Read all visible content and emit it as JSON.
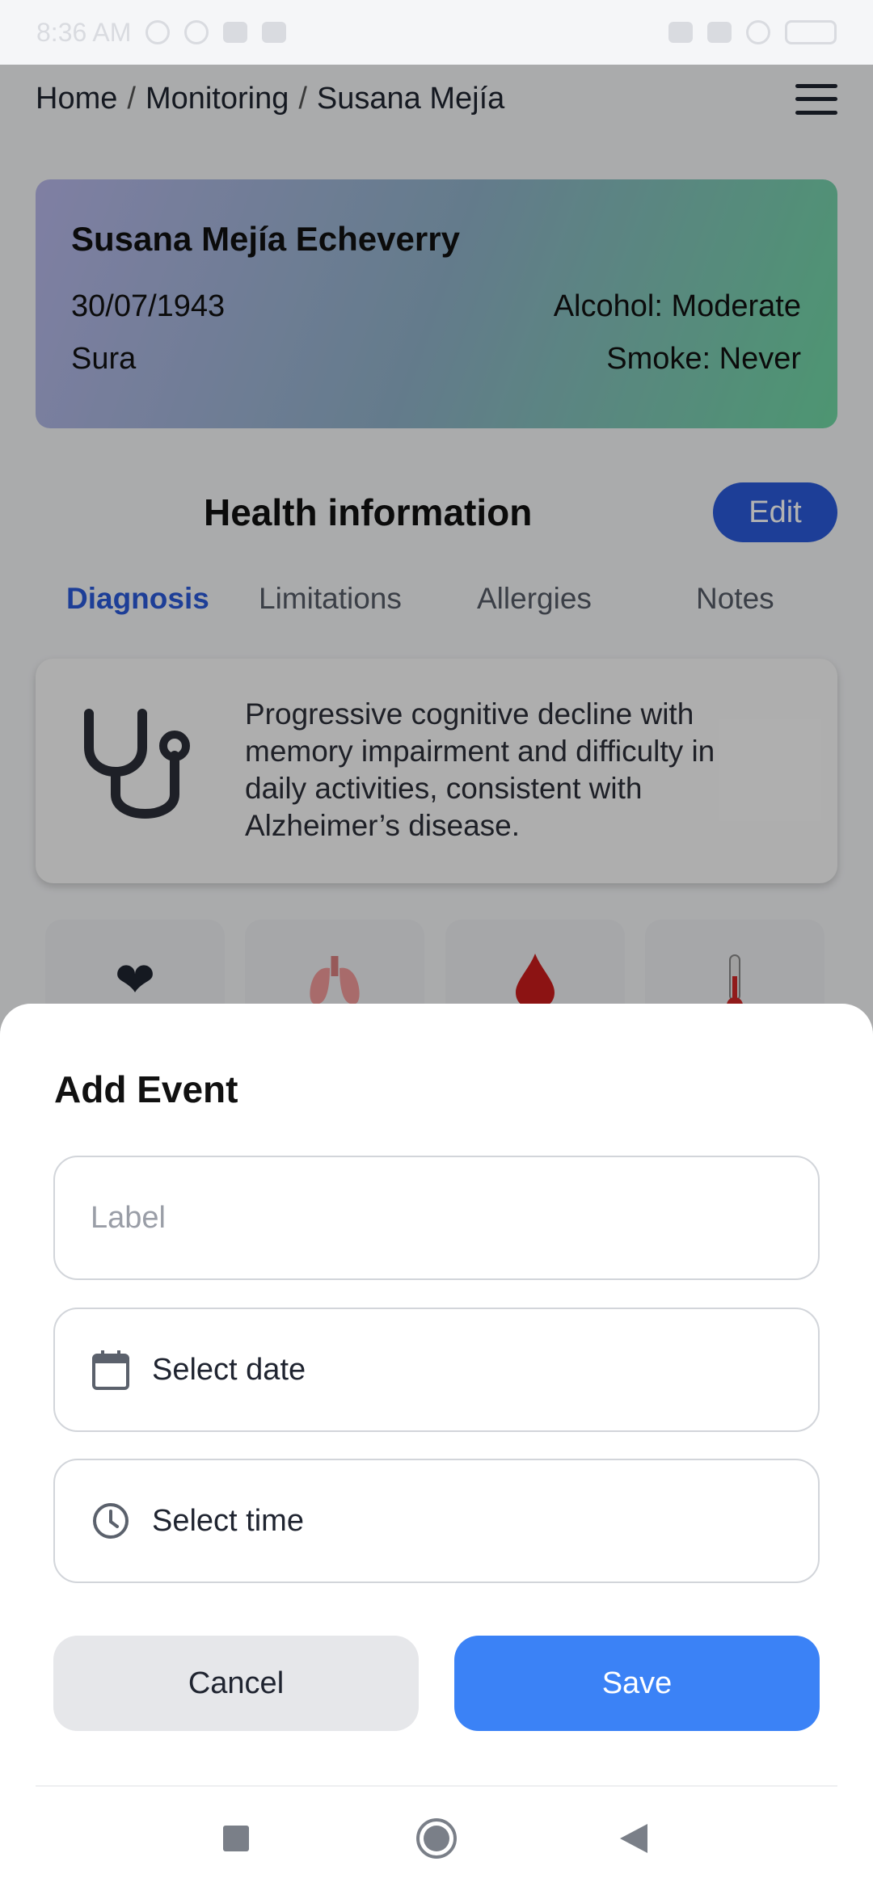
{
  "status_bar": {
    "time": "8:36 AM"
  },
  "breadcrumb": {
    "home": "Home",
    "monitoring": "Monitoring",
    "patient": "Susana Mejía",
    "separator": "/"
  },
  "patient": {
    "full_name": "Susana Mejía Echeverry",
    "birth_date": "30/07/1943",
    "alcohol": "Alcohol: Moderate",
    "insurer": "Sura",
    "smoke": "Smoke: Never",
    "card_gradient": [
      "#b7b7ea",
      "#8fb1c8",
      "#6fd7a3"
    ]
  },
  "health": {
    "title": "Health information",
    "edit_label": "Edit",
    "tabs": [
      {
        "label": "Diagnosis",
        "active": true
      },
      {
        "label": "Limitations",
        "active": false
      },
      {
        "label": "Allergies",
        "active": false
      },
      {
        "label": "Notes",
        "active": false
      }
    ],
    "diagnosis_text": "Progressive cognitive decline with memory impairment and difficulty in daily activities, consistent with Alzheimer’s disease.",
    "vitals_icons": [
      "heart-icon",
      "lungs-icon",
      "blood-drop-icon",
      "thermometer-icon"
    ]
  },
  "add_event": {
    "title": "Add Event",
    "label_placeholder": "Label",
    "date_text": "Select date",
    "time_text": "Select time",
    "cancel_label": "Cancel",
    "save_label": "Save"
  },
  "colors": {
    "accent": "#2a5ad9",
    "save_button": "#3b82f6",
    "cancel_button": "#e6e7ea"
  }
}
